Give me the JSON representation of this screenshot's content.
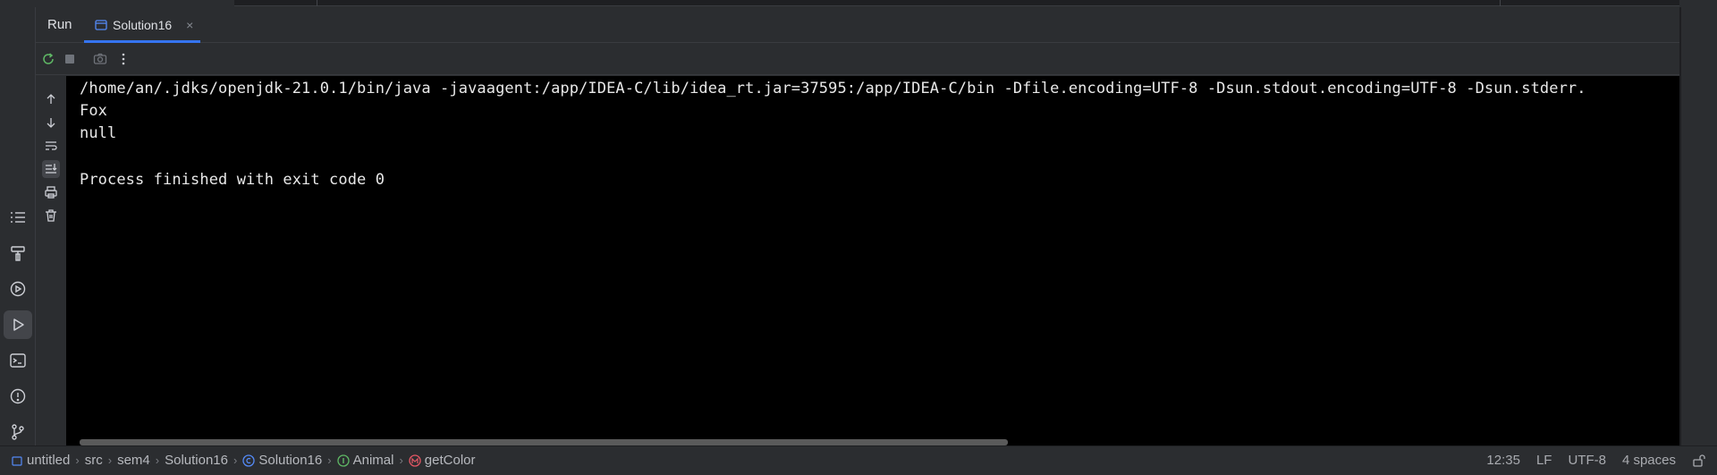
{
  "panel": {
    "title": "Run",
    "tab": {
      "label": "Solution16",
      "close": "×"
    }
  },
  "console": {
    "lines": [
      "/home/an/.jdks/openjdk-21.0.1/bin/java -javaagent:/app/IDEA-C/lib/idea_rt.jar=37595:/app/IDEA-C/bin -Dfile.encoding=UTF-8 -Dsun.stdout.encoding=UTF-8 -Dsun.stderr.",
      "Fox",
      "null",
      "",
      "Process finished with exit code 0"
    ]
  },
  "breadcrumbs": {
    "project": "untitled",
    "items": [
      "src",
      "sem4",
      "Solution16"
    ],
    "class_name": "Solution16",
    "interface_name": "Animal",
    "method_name": "getColor",
    "separator": "›"
  },
  "status": {
    "position": "12:35",
    "line_separator": "LF",
    "encoding": "UTF-8",
    "indent": "4 spaces"
  },
  "colors": {
    "accent": "#3574f0",
    "run_green": "#5fb865",
    "class_icon": "#548af7",
    "interface_icon": "#5fb865",
    "method_icon": "#e55765"
  }
}
